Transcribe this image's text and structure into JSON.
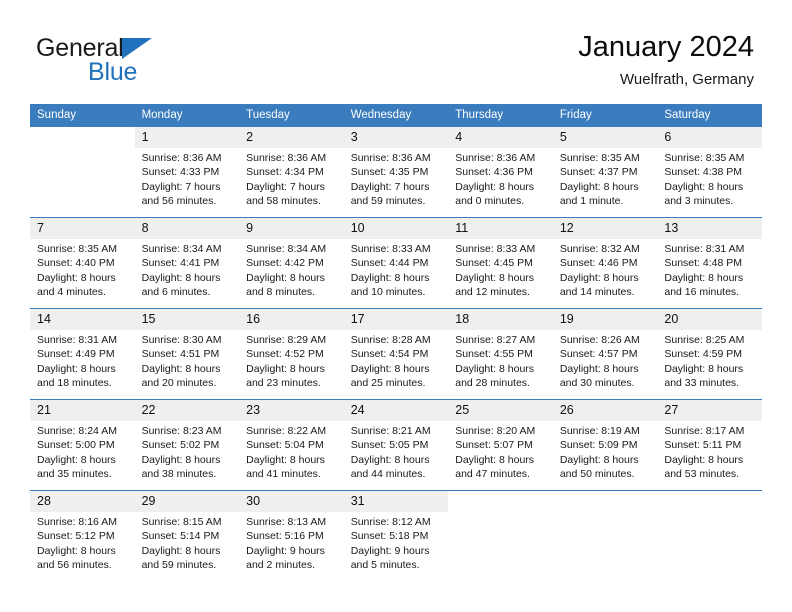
{
  "brand": {
    "name_dark": "General",
    "name_blue": "Blue",
    "triangle_color": "#1f72bb"
  },
  "header": {
    "title": "January 2024",
    "subtitle": "Wuelfrath, Germany",
    "accent_color": "#3a7cbe",
    "daynum_bg": "#efefef"
  },
  "columns": [
    "Sunday",
    "Monday",
    "Tuesday",
    "Wednesday",
    "Thursday",
    "Friday",
    "Saturday"
  ],
  "weeks": [
    [
      {
        "day": "",
        "sunrise": "",
        "sunset": "",
        "daylight1": "",
        "daylight2": ""
      },
      {
        "day": "1",
        "sunrise": "Sunrise: 8:36 AM",
        "sunset": "Sunset: 4:33 PM",
        "daylight1": "Daylight: 7 hours",
        "daylight2": "and 56 minutes."
      },
      {
        "day": "2",
        "sunrise": "Sunrise: 8:36 AM",
        "sunset": "Sunset: 4:34 PM",
        "daylight1": "Daylight: 7 hours",
        "daylight2": "and 58 minutes."
      },
      {
        "day": "3",
        "sunrise": "Sunrise: 8:36 AM",
        "sunset": "Sunset: 4:35 PM",
        "daylight1": "Daylight: 7 hours",
        "daylight2": "and 59 minutes."
      },
      {
        "day": "4",
        "sunrise": "Sunrise: 8:36 AM",
        "sunset": "Sunset: 4:36 PM",
        "daylight1": "Daylight: 8 hours",
        "daylight2": "and 0 minutes."
      },
      {
        "day": "5",
        "sunrise": "Sunrise: 8:35 AM",
        "sunset": "Sunset: 4:37 PM",
        "daylight1": "Daylight: 8 hours",
        "daylight2": "and 1 minute."
      },
      {
        "day": "6",
        "sunrise": "Sunrise: 8:35 AM",
        "sunset": "Sunset: 4:38 PM",
        "daylight1": "Daylight: 8 hours",
        "daylight2": "and 3 minutes."
      }
    ],
    [
      {
        "day": "7",
        "sunrise": "Sunrise: 8:35 AM",
        "sunset": "Sunset: 4:40 PM",
        "daylight1": "Daylight: 8 hours",
        "daylight2": "and 4 minutes."
      },
      {
        "day": "8",
        "sunrise": "Sunrise: 8:34 AM",
        "sunset": "Sunset: 4:41 PM",
        "daylight1": "Daylight: 8 hours",
        "daylight2": "and 6 minutes."
      },
      {
        "day": "9",
        "sunrise": "Sunrise: 8:34 AM",
        "sunset": "Sunset: 4:42 PM",
        "daylight1": "Daylight: 8 hours",
        "daylight2": "and 8 minutes."
      },
      {
        "day": "10",
        "sunrise": "Sunrise: 8:33 AM",
        "sunset": "Sunset: 4:44 PM",
        "daylight1": "Daylight: 8 hours",
        "daylight2": "and 10 minutes."
      },
      {
        "day": "11",
        "sunrise": "Sunrise: 8:33 AM",
        "sunset": "Sunset: 4:45 PM",
        "daylight1": "Daylight: 8 hours",
        "daylight2": "and 12 minutes."
      },
      {
        "day": "12",
        "sunrise": "Sunrise: 8:32 AM",
        "sunset": "Sunset: 4:46 PM",
        "daylight1": "Daylight: 8 hours",
        "daylight2": "and 14 minutes."
      },
      {
        "day": "13",
        "sunrise": "Sunrise: 8:31 AM",
        "sunset": "Sunset: 4:48 PM",
        "daylight1": "Daylight: 8 hours",
        "daylight2": "and 16 minutes."
      }
    ],
    [
      {
        "day": "14",
        "sunrise": "Sunrise: 8:31 AM",
        "sunset": "Sunset: 4:49 PM",
        "daylight1": "Daylight: 8 hours",
        "daylight2": "and 18 minutes."
      },
      {
        "day": "15",
        "sunrise": "Sunrise: 8:30 AM",
        "sunset": "Sunset: 4:51 PM",
        "daylight1": "Daylight: 8 hours",
        "daylight2": "and 20 minutes."
      },
      {
        "day": "16",
        "sunrise": "Sunrise: 8:29 AM",
        "sunset": "Sunset: 4:52 PM",
        "daylight1": "Daylight: 8 hours",
        "daylight2": "and 23 minutes."
      },
      {
        "day": "17",
        "sunrise": "Sunrise: 8:28 AM",
        "sunset": "Sunset: 4:54 PM",
        "daylight1": "Daylight: 8 hours",
        "daylight2": "and 25 minutes."
      },
      {
        "day": "18",
        "sunrise": "Sunrise: 8:27 AM",
        "sunset": "Sunset: 4:55 PM",
        "daylight1": "Daylight: 8 hours",
        "daylight2": "and 28 minutes."
      },
      {
        "day": "19",
        "sunrise": "Sunrise: 8:26 AM",
        "sunset": "Sunset: 4:57 PM",
        "daylight1": "Daylight: 8 hours",
        "daylight2": "and 30 minutes."
      },
      {
        "day": "20",
        "sunrise": "Sunrise: 8:25 AM",
        "sunset": "Sunset: 4:59 PM",
        "daylight1": "Daylight: 8 hours",
        "daylight2": "and 33 minutes."
      }
    ],
    [
      {
        "day": "21",
        "sunrise": "Sunrise: 8:24 AM",
        "sunset": "Sunset: 5:00 PM",
        "daylight1": "Daylight: 8 hours",
        "daylight2": "and 35 minutes."
      },
      {
        "day": "22",
        "sunrise": "Sunrise: 8:23 AM",
        "sunset": "Sunset: 5:02 PM",
        "daylight1": "Daylight: 8 hours",
        "daylight2": "and 38 minutes."
      },
      {
        "day": "23",
        "sunrise": "Sunrise: 8:22 AM",
        "sunset": "Sunset: 5:04 PM",
        "daylight1": "Daylight: 8 hours",
        "daylight2": "and 41 minutes."
      },
      {
        "day": "24",
        "sunrise": "Sunrise: 8:21 AM",
        "sunset": "Sunset: 5:05 PM",
        "daylight1": "Daylight: 8 hours",
        "daylight2": "and 44 minutes."
      },
      {
        "day": "25",
        "sunrise": "Sunrise: 8:20 AM",
        "sunset": "Sunset: 5:07 PM",
        "daylight1": "Daylight: 8 hours",
        "daylight2": "and 47 minutes."
      },
      {
        "day": "26",
        "sunrise": "Sunrise: 8:19 AM",
        "sunset": "Sunset: 5:09 PM",
        "daylight1": "Daylight: 8 hours",
        "daylight2": "and 50 minutes."
      },
      {
        "day": "27",
        "sunrise": "Sunrise: 8:17 AM",
        "sunset": "Sunset: 5:11 PM",
        "daylight1": "Daylight: 8 hours",
        "daylight2": "and 53 minutes."
      }
    ],
    [
      {
        "day": "28",
        "sunrise": "Sunrise: 8:16 AM",
        "sunset": "Sunset: 5:12 PM",
        "daylight1": "Daylight: 8 hours",
        "daylight2": "and 56 minutes."
      },
      {
        "day": "29",
        "sunrise": "Sunrise: 8:15 AM",
        "sunset": "Sunset: 5:14 PM",
        "daylight1": "Daylight: 8 hours",
        "daylight2": "and 59 minutes."
      },
      {
        "day": "30",
        "sunrise": "Sunrise: 8:13 AM",
        "sunset": "Sunset: 5:16 PM",
        "daylight1": "Daylight: 9 hours",
        "daylight2": "and 2 minutes."
      },
      {
        "day": "31",
        "sunrise": "Sunrise: 8:12 AM",
        "sunset": "Sunset: 5:18 PM",
        "daylight1": "Daylight: 9 hours",
        "daylight2": "and 5 minutes."
      },
      {
        "day": "",
        "sunrise": "",
        "sunset": "",
        "daylight1": "",
        "daylight2": ""
      },
      {
        "day": "",
        "sunrise": "",
        "sunset": "",
        "daylight1": "",
        "daylight2": ""
      },
      {
        "day": "",
        "sunrise": "",
        "sunset": "",
        "daylight1": "",
        "daylight2": ""
      }
    ]
  ]
}
